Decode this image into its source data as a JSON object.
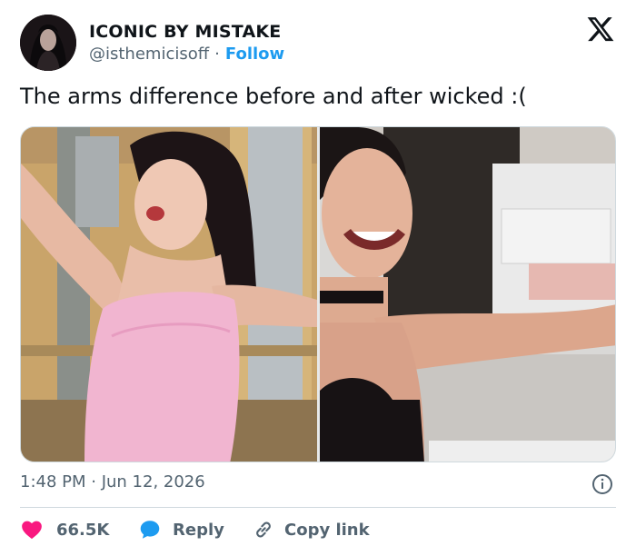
{
  "author": {
    "display_name": "ICONIC BY MISTAKE",
    "handle": "@isthemicisoff",
    "separator": "·",
    "follow_label": "Follow"
  },
  "tweet": {
    "text": "The arms difference before and after wicked :(",
    "timestamp": "1:48 PM · Jun 12, 2026"
  },
  "media": {
    "images": [
      {
        "description_icon": "photo-before"
      },
      {
        "description_icon": "photo-after"
      }
    ]
  },
  "actions": {
    "like_count": "66.5K",
    "reply_label": "Reply",
    "copy_link_label": "Copy link"
  },
  "colors": {
    "like": "#f91880",
    "reply": "#1d9bf0",
    "link": "#1d9bf0",
    "muted": "#536471",
    "text": "#0f1419",
    "border": "#cfd9de"
  },
  "icons": [
    "x-logo-icon",
    "heart-icon",
    "reply-bubble-icon",
    "link-icon",
    "info-icon"
  ]
}
